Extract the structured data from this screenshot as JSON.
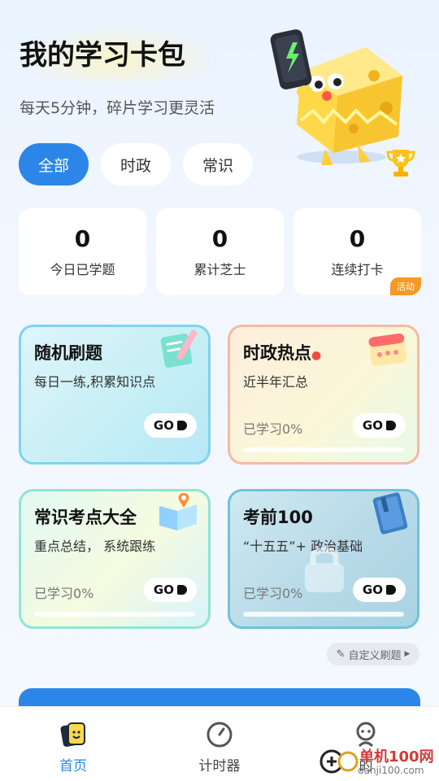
{
  "header": {
    "title": "我的学习卡包",
    "subtitle": "每天5分钟，碎片学习更灵活"
  },
  "tabs": [
    {
      "label": "全部",
      "active": true
    },
    {
      "label": "时政",
      "active": false
    },
    {
      "label": "常识",
      "active": false
    }
  ],
  "stats": [
    {
      "value": "0",
      "label": "今日已学题"
    },
    {
      "value": "0",
      "label": "累计芝士"
    },
    {
      "value": "0",
      "label": "连续打卡",
      "badge": "活动"
    }
  ],
  "cards": [
    {
      "title": "随机刷题",
      "desc": "每日一练,积累知识点",
      "progress": "",
      "go": "GO",
      "icon": "pencil-note-icon"
    },
    {
      "title": "时政热点",
      "desc": "近半年汇总",
      "progress": "已学习0%",
      "go": "GO",
      "icon": "calendar-icon"
    },
    {
      "title": "常识考点大全",
      "desc": "重点总结， 系统跟练",
      "progress": "已学习0%",
      "go": "GO",
      "icon": "map-book-icon"
    },
    {
      "title": "考前100",
      "desc": "“十五五”+ 政治基础",
      "progress": "已学习0%",
      "go": "GO",
      "icon": "blue-book-icon",
      "locked": true
    }
  ],
  "custom_button": {
    "label": "自定义刷题"
  },
  "tabbar": [
    {
      "label": "首页",
      "icon": "card-face-icon",
      "active": true
    },
    {
      "label": "计时器",
      "icon": "timer-icon",
      "active": false
    },
    {
      "label": "的",
      "icon": "profile-icon",
      "active": false
    }
  ],
  "watermark": {
    "text": "单机100网",
    "sub": "danji100.com"
  },
  "colors": {
    "primary": "#2b86e8",
    "badge": "#f59a23"
  }
}
